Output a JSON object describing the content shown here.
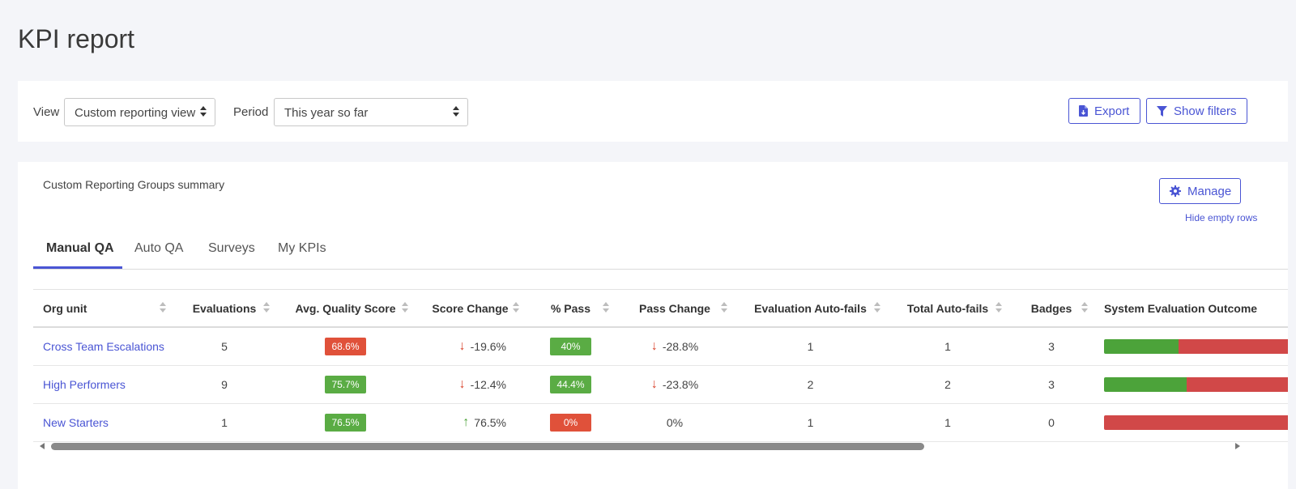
{
  "page": {
    "title": "KPI report"
  },
  "filters": {
    "view_label": "View",
    "view_value": "Custom reporting view",
    "period_label": "Period",
    "period_value": "This year so far",
    "export_label": "Export",
    "show_filters_label": "Show filters"
  },
  "summary": {
    "title": "Custom Reporting Groups summary",
    "manage_label": "Manage",
    "hide_empty_label": "Hide empty rows"
  },
  "tabs": [
    {
      "label": "Manual QA",
      "active": true
    },
    {
      "label": "Auto QA",
      "active": false
    },
    {
      "label": "Surveys",
      "active": false
    },
    {
      "label": "My KPIs",
      "active": false
    }
  ],
  "table": {
    "columns": [
      "Org unit",
      "Evaluations",
      "Avg. Quality Score",
      "Score Change",
      "% Pass",
      "Pass Change",
      "Evaluation Auto-fails",
      "Total Auto-fails",
      "Badges",
      "System Evaluation Outcome"
    ],
    "rows": [
      {
        "org_unit": "Cross Team Escalations",
        "evaluations": "5",
        "avg_quality_score": "68.6%",
        "score_status": "red",
        "score_change": "-19.6%",
        "score_direction": "down",
        "pass_pct": "40%",
        "pass_status": "green",
        "pass_change": "-28.8%",
        "pass_direction": "down",
        "evaluation_auto_fails": "1",
        "total_auto_fails": "1",
        "badges": "3",
        "outcome_pass_fraction": 0.4
      },
      {
        "org_unit": "High Performers",
        "evaluations": "9",
        "avg_quality_score": "75.7%",
        "score_status": "green",
        "score_change": "-12.4%",
        "score_direction": "down",
        "pass_pct": "44.4%",
        "pass_status": "green",
        "pass_change": "-23.8%",
        "pass_direction": "down",
        "evaluation_auto_fails": "2",
        "total_auto_fails": "2",
        "badges": "3",
        "outcome_pass_fraction": 0.444
      },
      {
        "org_unit": "New Starters",
        "evaluations": "1",
        "avg_quality_score": "76.5%",
        "score_status": "green",
        "score_change": "76.5%",
        "score_direction": "up",
        "pass_pct": "0%",
        "pass_status": "red",
        "pass_change": "0%",
        "pass_direction": "none",
        "evaluation_auto_fails": "1",
        "total_auto_fails": "1",
        "badges": "0",
        "outcome_pass_fraction": 0
      }
    ]
  },
  "colors": {
    "accent": "#4a55d4",
    "green": "#5aac44",
    "red": "#e0513a",
    "bar_green": "#4ca33a",
    "bar_red": "#d14848",
    "arrow_down": "#d9432c",
    "arrow_up": "#4ca33a"
  },
  "icons": {
    "export": "file-export-icon",
    "filter": "funnel-icon",
    "manage": "gear-icon",
    "arrow_down": "arrow-down-icon",
    "arrow_up": "arrow-up-icon"
  }
}
